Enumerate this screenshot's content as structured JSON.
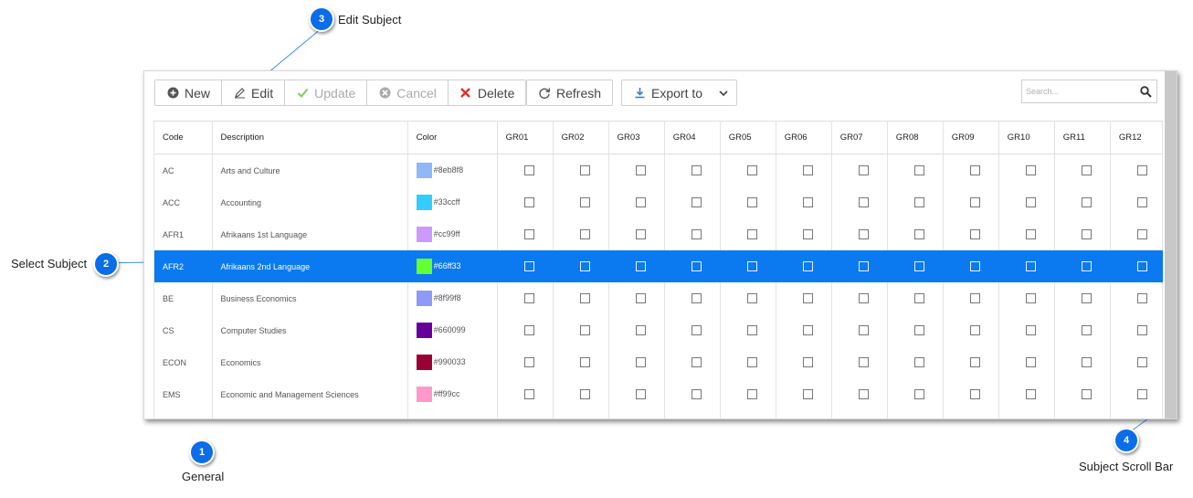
{
  "toolbar": {
    "new_label": "New",
    "edit_label": "Edit",
    "update_label": "Update",
    "cancel_label": "Cancel",
    "delete_label": "Delete",
    "refresh_label": "Refresh",
    "export_label": "Export to"
  },
  "search": {
    "placeholder": "Search..."
  },
  "table": {
    "headers": [
      "Code",
      "Description",
      "Color",
      "GR01",
      "GR02",
      "GR03",
      "GR04",
      "GR05",
      "GR06",
      "GR07",
      "GR08",
      "GR09",
      "GR10",
      "GR11",
      "GR12"
    ],
    "rows": [
      {
        "code": "AC",
        "description": "Arts and Culture",
        "color": "#8eb8f8",
        "color_label": "#8eb8f8",
        "selected": false
      },
      {
        "code": "ACC",
        "description": "Accounting",
        "color": "#33ccff",
        "color_label": "#33ccff",
        "selected": false
      },
      {
        "code": "AFR1",
        "description": "Afrikaans 1st Language",
        "color": "#cc99ff",
        "color_label": "#cc99ff",
        "selected": false
      },
      {
        "code": "AFR2",
        "description": "Afrikaans 2nd Language",
        "color": "#66ff33",
        "color_label": "#66ff33",
        "selected": true
      },
      {
        "code": "BE",
        "description": "Business Economics",
        "color": "#8f99f8",
        "color_label": "#8f99f8",
        "selected": false
      },
      {
        "code": "CS",
        "description": "Computer Studies",
        "color": "#660099",
        "color_label": "#660099",
        "selected": false
      },
      {
        "code": "ECON",
        "description": "Economics",
        "color": "#990033",
        "color_label": "#990033",
        "selected": false
      },
      {
        "code": "EMS",
        "description": "Economic and Management Sciences",
        "color": "#ff99cc",
        "color_label": "#ff99cc",
        "selected": false
      },
      {
        "code": "",
        "description": "",
        "color": "#1133cc",
        "color_label": "",
        "selected": false
      }
    ]
  },
  "callouts": {
    "c1": {
      "num": "1",
      "label": "General"
    },
    "c2": {
      "num": "2",
      "label": "Select Subject"
    },
    "c3": {
      "num": "3",
      "label": "Edit Subject"
    },
    "c4": {
      "num": "4",
      "label": "Subject Scroll Bar"
    }
  },
  "colors": {
    "accent": "#0b7af0",
    "marker": "#0b6ee8",
    "delete": "#e03030",
    "update": "#7ccc66"
  }
}
